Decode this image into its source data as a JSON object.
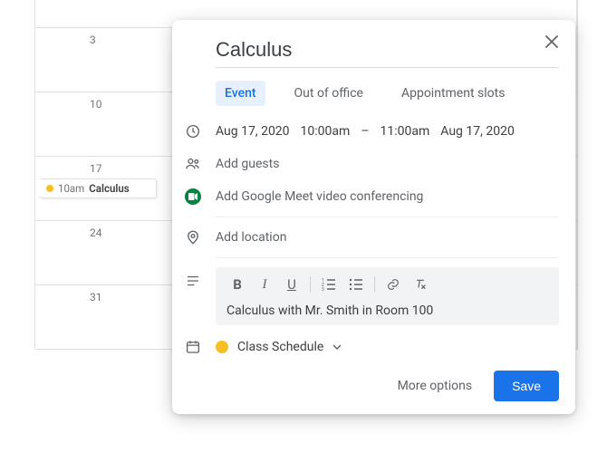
{
  "calendar": {
    "dates": [
      "3",
      "10",
      "17",
      "24",
      "31"
    ],
    "chip": {
      "time": "10am",
      "title": "Calculus"
    }
  },
  "modal": {
    "title": "Calculus",
    "tabs": {
      "event": "Event",
      "ooo": "Out of office",
      "slots": "Appointment slots"
    },
    "start_date": "Aug 17, 2020",
    "start_time": "10:00am",
    "dash": "–",
    "end_time": "11:00am",
    "end_date": "Aug 17, 2020",
    "guests_placeholder": "Add guests",
    "meet_label": "Add Google Meet video conferencing",
    "location_placeholder": "Add location",
    "description": "Calculus with Mr. Smith in Room 100",
    "calendar_name": "Class Schedule",
    "more_options": "More options",
    "save": "Save"
  },
  "colors": {
    "accent": "#1a73e8",
    "cal_dot": "#f6bf26"
  }
}
